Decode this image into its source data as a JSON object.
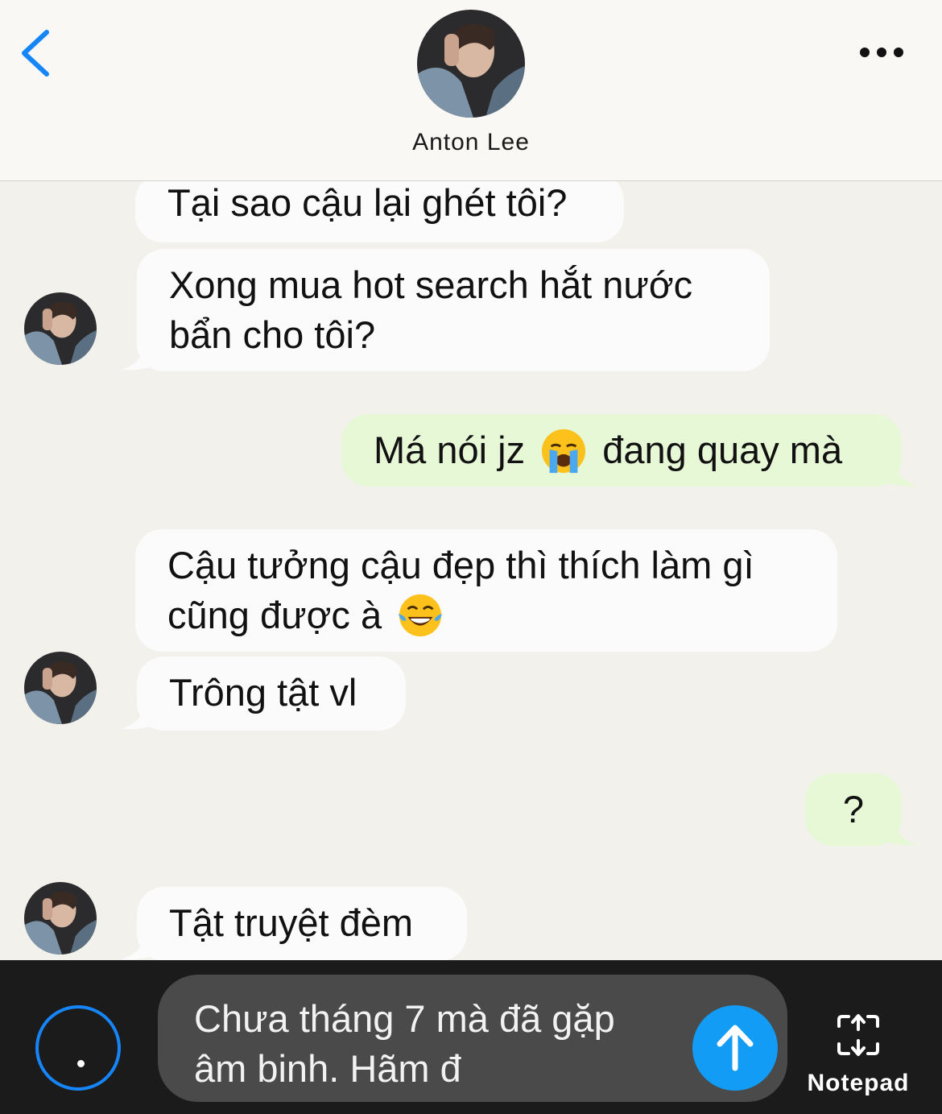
{
  "header": {
    "contact_name": "Anton Lee"
  },
  "messages": [
    {
      "from": "contact",
      "text": "Tại sao cậu lại ghét tôi?"
    },
    {
      "from": "contact",
      "line1": "Xong mua hot search hắt nước",
      "line2": "bẩn cho tôi?"
    },
    {
      "from": "me",
      "before_emoji": "Má nói jz",
      "emoji": "loudly-crying-face",
      "after_emoji": "đang quay mà"
    },
    {
      "from": "contact",
      "line1": "Cậu tưởng cậu đẹp thì thích làm gì",
      "line2_before_emoji": "cũng được à",
      "emoji": "tears-of-joy-face"
    },
    {
      "from": "contact",
      "text": "Trông tật vl"
    },
    {
      "from": "me",
      "text": "?"
    },
    {
      "from": "contact",
      "text": "Tật truyệt đèm"
    }
  ],
  "composer": {
    "line1": "Chưa tháng 7 mà đã gặp",
    "line2": "âm binh. Hãm đ",
    "notepad_label": "Notepad"
  },
  "colors": {
    "accent_blue": "#1685f8",
    "send_blue": "#129cf5",
    "incoming_bubble": "#fbfbfb",
    "outgoing_bubble": "#e6f8d6",
    "chat_background": "#f3f1ec",
    "bottom_bar": "#1b1b1b"
  }
}
